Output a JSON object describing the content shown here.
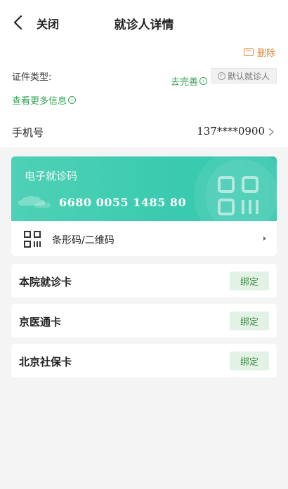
{
  "nav": {
    "back_icon": "back-chevron-icon",
    "close_label": "关闭",
    "title": "就诊人详情"
  },
  "patient": {
    "delete_label": "删除",
    "id_type_label": "证件类型:",
    "complete_label": "去完善",
    "default_label": "默认就诊人",
    "more_info_label": "查看更多信息",
    "phone_label": "手机号",
    "phone_value": "137****0900"
  },
  "e_card": {
    "title": "电子就诊码",
    "number": "6680 0055 1485 80",
    "code_label": "条形码/二维码"
  },
  "bind_cards": [
    {
      "label": "本院就诊卡",
      "action": "绑定"
    },
    {
      "label": "京医通卡",
      "action": "绑定"
    },
    {
      "label": "北京社保卡",
      "action": "绑定"
    }
  ],
  "colors": {
    "accent_green": "#3aa55a",
    "delete_orange": "#e0893a",
    "card_teal": "#3ccbb0",
    "bind_bg": "#e3f2e6"
  }
}
